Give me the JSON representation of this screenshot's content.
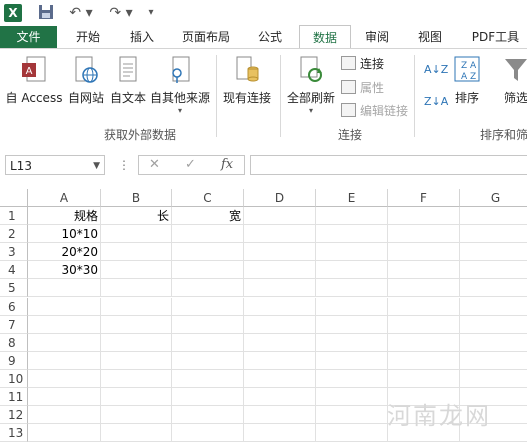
{
  "qat": {
    "app_icon": "X",
    "save_icon": "save-icon",
    "undo_icon": "undo-icon",
    "redo_icon": "redo-icon"
  },
  "tabs": [
    "文件",
    "开始",
    "插入",
    "页面布局",
    "公式",
    "数据",
    "审阅",
    "视图",
    "PDF工具"
  ],
  "ribbon": {
    "from_access": "自 Access",
    "from_web": "自网站",
    "from_text": "自文本",
    "from_other": "自其他来源",
    "existing_conn": "现有连接",
    "refresh_all": "全部刷新",
    "connections": "连接",
    "properties": "属性",
    "edit_links": "编辑链接",
    "sort": "排序",
    "filter": "筛选",
    "group_get_external": "获取外部数据",
    "group_connections": "连接",
    "group_sort": "排序和筛"
  },
  "formula_bar": {
    "name_box": "L13",
    "fx": "fx",
    "cancel": "✕",
    "enter": "✓"
  },
  "sheet": {
    "columns": [
      "A",
      "B",
      "C",
      "D",
      "E",
      "F",
      "G"
    ],
    "rows": [
      "1",
      "2",
      "3",
      "4",
      "5",
      "6",
      "7",
      "8",
      "9",
      "10",
      "11",
      "12",
      "13"
    ],
    "cells": {
      "A1": "规格",
      "B1": "长",
      "C1": "宽",
      "A2": "10*10",
      "A3": "20*20",
      "A4": "30*30"
    }
  },
  "watermark": "河南龙网"
}
